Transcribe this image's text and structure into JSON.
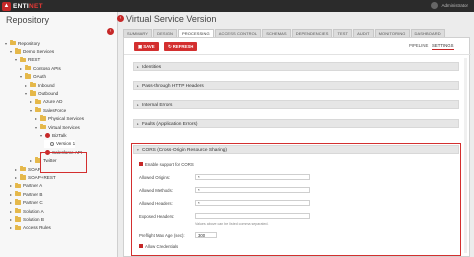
{
  "app": {
    "logo_badge": "▲",
    "logo_text": "ENTI",
    "logo_accent": "NET",
    "user_name": "Administrator"
  },
  "left": {
    "title": "Repository",
    "tree": [
      {
        "label": "Repository",
        "indent": 0,
        "icon": "folder-icon",
        "exp": "▾"
      },
      {
        "label": "Demo Services",
        "indent": 1,
        "icon": "folder-icon",
        "exp": "▾"
      },
      {
        "label": "REST",
        "indent": 2,
        "icon": "folder-icon",
        "exp": "▾"
      },
      {
        "label": "Contoso APIs",
        "indent": 3,
        "icon": "folder-icon",
        "exp": "▸"
      },
      {
        "label": "OAuth",
        "indent": 3,
        "icon": "folder-icon",
        "exp": "▾"
      },
      {
        "label": "Inbound",
        "indent": 4,
        "icon": "folder-icon",
        "exp": "▸"
      },
      {
        "label": "Outbound",
        "indent": 4,
        "icon": "folder-icon",
        "exp": "▾"
      },
      {
        "label": "Azure AD",
        "indent": 5,
        "icon": "folder-icon",
        "exp": "▸"
      },
      {
        "label": "SalesForce",
        "indent": 5,
        "icon": "folder-icon",
        "exp": "▾"
      },
      {
        "label": "Physical Services",
        "indent": 6,
        "icon": "folder-icon",
        "exp": "▸"
      },
      {
        "label": "Virtual Services",
        "indent": 6,
        "icon": "folder-icon",
        "exp": "▾"
      },
      {
        "label": "BizTalk",
        "indent": 7,
        "icon": "biztalk-icon",
        "exp": "▾"
      },
      {
        "label": "Version 1",
        "indent": 8,
        "icon": "version-icon",
        "exp": ""
      },
      {
        "label": "Salesforce API",
        "indent": 7,
        "icon": "biztalk-icon",
        "exp": "▸"
      },
      {
        "label": "Twitter",
        "indent": 5,
        "icon": "folder-icon",
        "exp": "▸"
      },
      {
        "label": "SOAP",
        "indent": 2,
        "icon": "folder-icon",
        "exp": "▸"
      },
      {
        "label": "SOAP+REST",
        "indent": 2,
        "icon": "folder-icon",
        "exp": "▸"
      },
      {
        "label": "Partner A",
        "indent": 1,
        "icon": "folder-icon",
        "exp": "▸"
      },
      {
        "label": "Partner B",
        "indent": 1,
        "icon": "folder-icon",
        "exp": "▸"
      },
      {
        "label": "Partner C",
        "indent": 1,
        "icon": "folder-icon",
        "exp": "▸"
      },
      {
        "label": "Solution A",
        "indent": 1,
        "icon": "folder-icon",
        "exp": "▸"
      },
      {
        "label": "Solution B",
        "indent": 1,
        "icon": "folder-icon",
        "exp": "▸"
      },
      {
        "label": "Access Rules",
        "indent": 1,
        "icon": "folder-icon",
        "exp": "▸"
      }
    ]
  },
  "main": {
    "title": "Virtual Service Version",
    "tabs": [
      "SUMMARY",
      "DESIGN",
      "PROCESSING",
      "ACCESS CONTROL",
      "SCHEMAS",
      "DEPENDENCIES",
      "TEST",
      "AUDIT",
      "MONITORING",
      "DASHBOARD"
    ],
    "active_tab": "PROCESSING",
    "save_label": "SAVE",
    "refresh_label": "REFRESH",
    "subtabs": [
      "PIPELINE",
      "SETTINGS"
    ],
    "sections": [
      "Identities",
      "Pass-through HTTP Headers",
      "Internal Errors",
      "Faults (Application Errors)"
    ],
    "cors": {
      "header": "CORS (Cross-Origin Resource Sharing)",
      "enable_label": "Enable support for CORS",
      "allowed_origins_label": "Allowed Origins:",
      "allowed_origins_value": "*",
      "allowed_methods_label": "Allowed Methods:",
      "allowed_methods_value": "*",
      "allowed_headers_label": "Allowed Headers:",
      "allowed_headers_value": "*",
      "exposed_headers_label": "Exposed Headers:",
      "exposed_headers_value": "",
      "hint": "Values above can be listed comma separated.",
      "max_age_label": "Preflight Max Age (sec):",
      "max_age_value": "300",
      "credentials_label": "Allow Credentials"
    }
  },
  "colors": {
    "accent": "#c62828",
    "topbar": "#2b2b2b"
  }
}
